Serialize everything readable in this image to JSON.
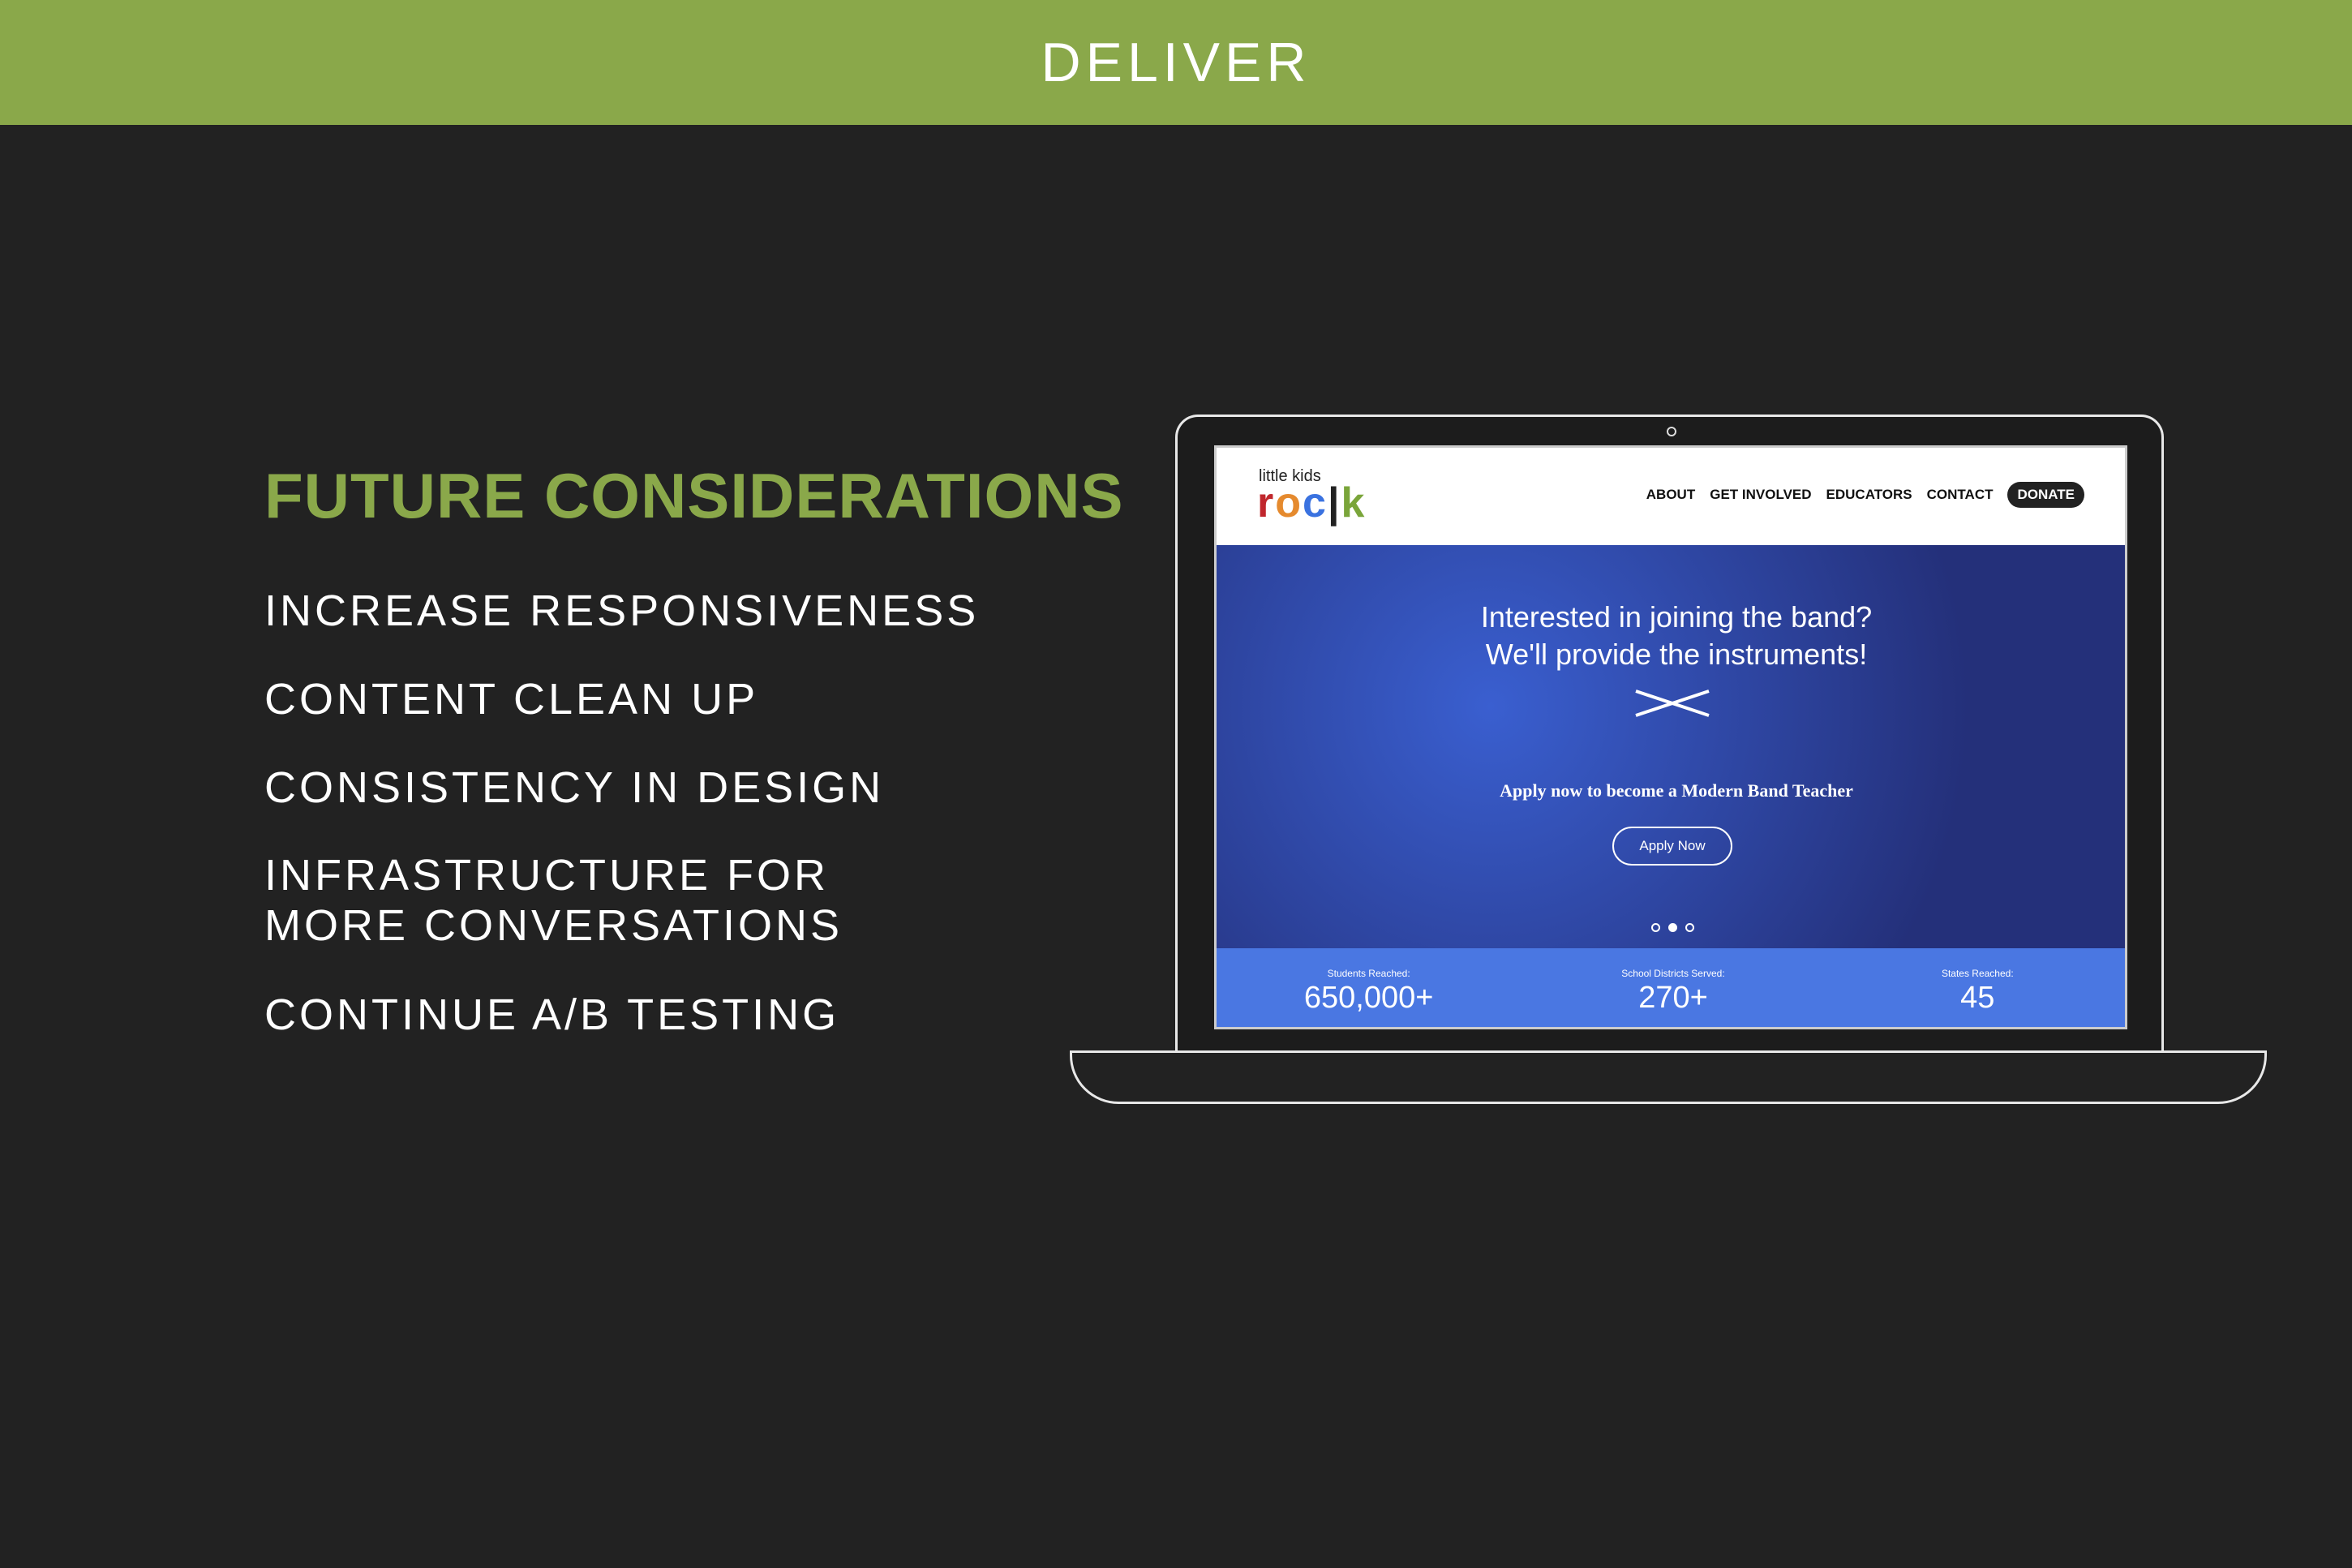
{
  "header": {
    "title": "DELIVER"
  },
  "colors": {
    "accent": "#8aa84a",
    "background": "#222222",
    "stats_bar": "#4a77e2"
  },
  "section": {
    "title": "FUTURE CONSIDERATIONS",
    "items": [
      "INCREASE RESPONSIVENESS",
      "CONTENT CLEAN UP",
      "CONSISTENCY IN DESIGN",
      "INFRASTRUCTURE FOR",
      "MORE CONVERSATIONS",
      "CONTINUE A/B TESTING"
    ]
  },
  "site": {
    "logo_small": "little kids",
    "logo_big": "rock",
    "nav": [
      "ABOUT",
      "GET INVOLVED",
      "EDUCATORS",
      "CONTACT"
    ],
    "donate": "DONATE",
    "hero": {
      "line1": "Interested in joining the band?",
      "line2": "We'll provide the instruments!",
      "sub": "Apply now to become a Modern Band Teacher",
      "button": "Apply Now"
    },
    "stats": [
      {
        "label": "Students Reached:",
        "value": "650,000+"
      },
      {
        "label": "School Districts Served:",
        "value": "270+"
      },
      {
        "label": "States Reached:",
        "value": "45"
      }
    ]
  }
}
